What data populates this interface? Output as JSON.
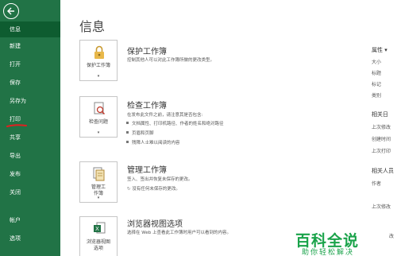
{
  "sidebar": {
    "items": [
      {
        "label": "信息"
      },
      {
        "label": "新建"
      },
      {
        "label": "打开"
      },
      {
        "label": "保存"
      },
      {
        "label": "另存为"
      },
      {
        "label": "打印"
      },
      {
        "label": "共享"
      },
      {
        "label": "导出"
      },
      {
        "label": "发布"
      },
      {
        "label": "关闭"
      },
      {
        "label": "帐户"
      },
      {
        "label": "选项"
      }
    ],
    "active_color": "#0e5c30",
    "bg_color": "#217346"
  },
  "main": {
    "title": "信息",
    "sections": {
      "protect": {
        "button_label": "保护工作簿",
        "title": "保护工作簿",
        "desc": "控制其他人可以对此工作簿所做的更改类型。",
        "icon": "lock-icon"
      },
      "inspect": {
        "button_label": "检查问题",
        "title": "检查工作簿",
        "desc": "在发布此文件之前，请注意其是否包含:",
        "bullets": [
          "文档属性、打印机路径、作者的姓名和绝对路径",
          "页眉和页脚",
          "残障人士难以阅读的内容"
        ],
        "icon": "inspect-icon"
      },
      "manage": {
        "button_label_1": "管理工",
        "button_label_2": "作簿",
        "title": "管理工作簿",
        "desc": "签入、签出并恢复未保存的更改。",
        "note": "没有任何未保存的更改。",
        "icon": "manage-workbook-icon"
      },
      "browser": {
        "button_label_1": "浏览器视图",
        "button_label_2": "选项",
        "title": "浏览器视图选项",
        "desc": "选择在 Web 上查看此工作簿时用户可以看到的内容。",
        "icon": "excel-browser-icon"
      }
    }
  },
  "properties": {
    "header": "属性",
    "items": [
      "大小",
      "标题",
      "标记",
      "类别"
    ],
    "related_dates": "相关日",
    "date_items": [
      "上次修改",
      "创建时间",
      "上次打印"
    ],
    "related_people": "相关人员",
    "people_items": [
      "作者",
      "上次修改"
    ],
    "partial": "改"
  },
  "watermark": {
    "main": "百科全说",
    "sub": "助你轻松解决"
  }
}
